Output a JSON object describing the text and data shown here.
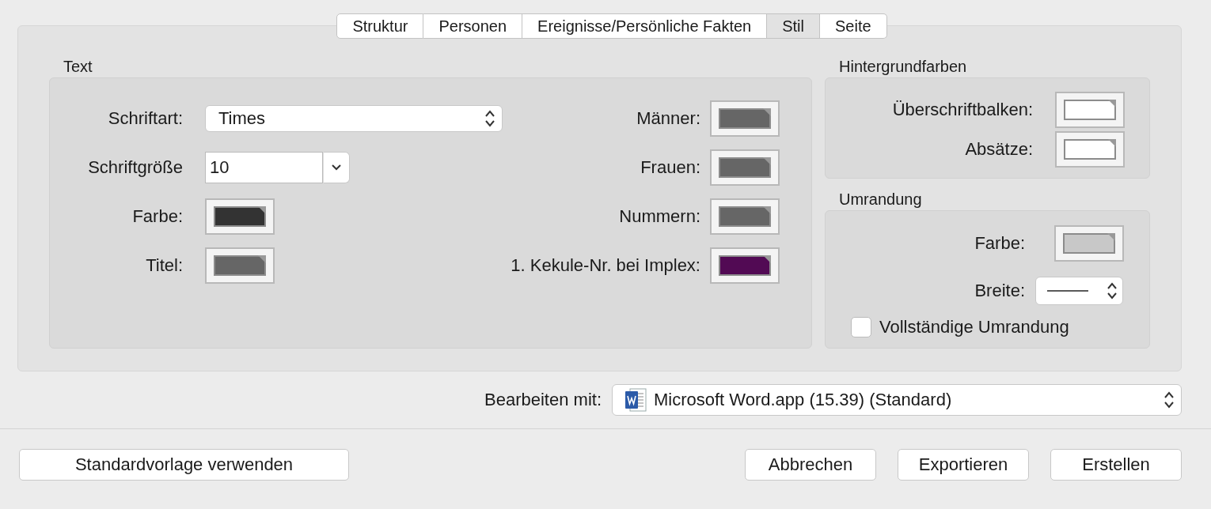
{
  "tabs": [
    {
      "label": "Struktur",
      "selected": false
    },
    {
      "label": "Personen",
      "selected": false
    },
    {
      "label": "Ereignisse/Persönliche Fakten",
      "selected": false
    },
    {
      "label": "Stil",
      "selected": true
    },
    {
      "label": "Seite",
      "selected": false
    }
  ],
  "text_group": {
    "title": "Text",
    "font": {
      "label": "Schriftart:",
      "value": "Times"
    },
    "font_size": {
      "label": "Schriftgröße",
      "value": "10"
    },
    "left_colors": [
      {
        "label": "Farbe:",
        "color": "#333333"
      },
      {
        "label": "Titel:",
        "color": "#666666"
      }
    ],
    "right_colors": [
      {
        "label": "Männer:",
        "color": "#666666"
      },
      {
        "label": "Frauen:",
        "color": "#666666"
      },
      {
        "label": "Nummern:",
        "color": "#666666"
      },
      {
        "label": "1. Kekule-Nr. bei Implex:",
        "color": "#520a54"
      }
    ]
  },
  "background_colors": {
    "title": "Hintergrundfarben",
    "items": [
      {
        "label": "Überschriftbalken:",
        "color": "#ffffff"
      },
      {
        "label": "Absätze:",
        "color": "#ffffff"
      }
    ]
  },
  "border": {
    "title": "Umrandung",
    "color": {
      "label": "Farbe:",
      "color": "#c8c8c8"
    },
    "width": {
      "label": "Breite:"
    },
    "full_border": {
      "label": "Vollständige Umrandung",
      "checked": false
    }
  },
  "edit_with": {
    "label": "Bearbeiten mit:",
    "value": "Microsoft Word.app (15.39) (Standard)"
  },
  "buttons_left": [
    "Standardvorlage verwenden"
  ],
  "buttons_right": [
    "Abbrechen",
    "Exportieren",
    "Erstellen"
  ]
}
